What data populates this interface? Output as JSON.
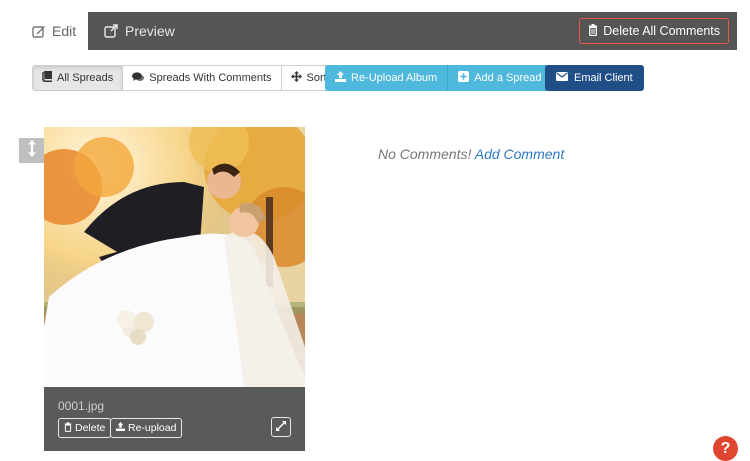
{
  "tabs": {
    "edit_label": "Edit",
    "preview_label": "Preview"
  },
  "header": {
    "delete_all_label": "Delete All Comments"
  },
  "toolbar": {
    "all_spreads_label": "All Spreads",
    "spreads_with_comments_label": "Spreads With Comments",
    "sort_label": "Sort",
    "reupload_album_label": "Re-Upload Album",
    "add_spread_label": "Add a Spread",
    "email_client_label": "Email Client"
  },
  "spread": {
    "filename": "0001.jpg",
    "delete_label": "Delete",
    "reupload_label": "Re-upload"
  },
  "comments": {
    "empty_label": "No Comments!",
    "add_label": "Add Comment"
  },
  "help": {
    "label": "?"
  },
  "colors": {
    "topbar": "#555555",
    "accent_blue": "#4fb8dd",
    "email_navy": "#1f4f86",
    "delete_red": "#e8574a",
    "link_blue": "#2f79c4",
    "help_red": "#e0452f"
  },
  "icons": {
    "edit_tab": "pencil-square-icon",
    "preview_tab": "external-link-icon",
    "delete_all": "trash-icon",
    "all_spreads": "book-icon",
    "spreads_with_comments": "comments-icon",
    "sort": "move-arrows-icon",
    "reupload_album": "upload-icon",
    "add_spread": "plus-square-icon",
    "email_client": "envelope-icon",
    "drag_handle": "vertical-arrows-icon",
    "spread_delete": "trash-icon",
    "spread_reupload": "upload-icon",
    "expand": "expand-icon"
  }
}
